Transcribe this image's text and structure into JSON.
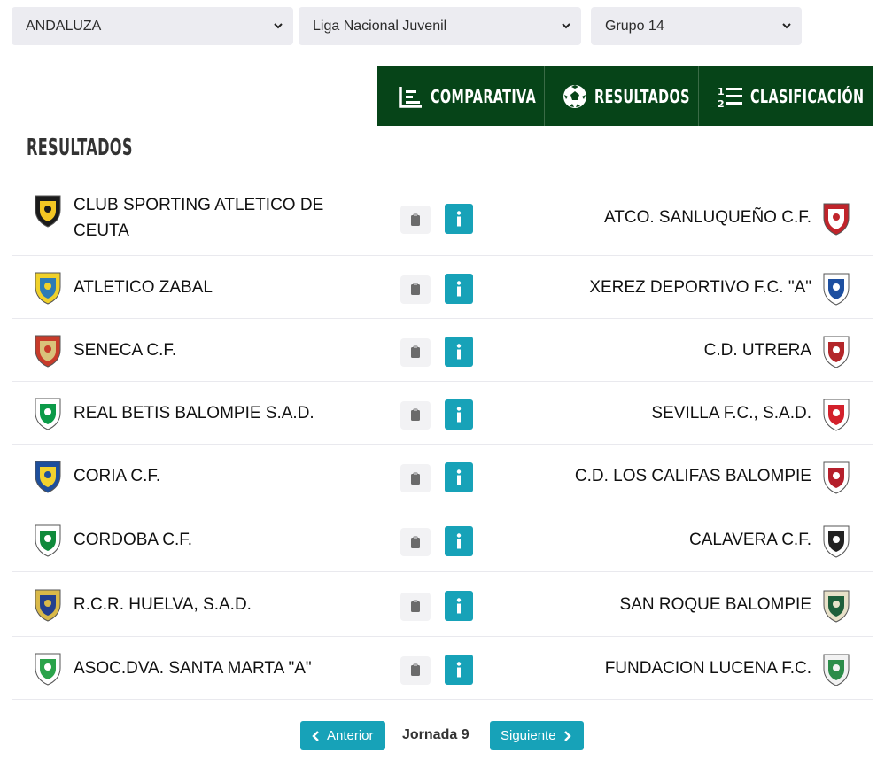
{
  "filters": {
    "region": "ANDALUZA",
    "competition": "Liga Nacional Juvenil",
    "group": "Grupo 14"
  },
  "tabs": [
    {
      "label": "COMPARATIVA",
      "icon": "bar-chart-icon"
    },
    {
      "label": "RESULTADOS",
      "icon": "soccer-ball-icon"
    },
    {
      "label": "CLASIFICACIÓN",
      "icon": "ranking-list-icon"
    }
  ],
  "section_title": "RESULTADOS",
  "matches": [
    {
      "home": "CLUB SPORTING ATLETICO DE CEUTA",
      "away": "ATCO. SANLUQUEÑO C.F.",
      "home_colors": [
        "#f3c623",
        "#1b1b1b"
      ],
      "away_colors": [
        "#ffffff",
        "#c0242b"
      ]
    },
    {
      "home": "ATLETICO ZABAL",
      "away": "XEREZ DEPORTIVO F.C. \"A\"",
      "home_colors": [
        "#2d7bb5",
        "#f0d12a"
      ],
      "away_colors": [
        "#1d4fa0",
        "#ffffff"
      ]
    },
    {
      "home": "SENECA C.F.",
      "away": "C.D. UTRERA",
      "home_colors": [
        "#d9c27a",
        "#c83b2a"
      ],
      "away_colors": [
        "#b3262a",
        "#ffffff"
      ]
    },
    {
      "home": "REAL BETIS BALOMPIE S.A.D.",
      "away": "SEVILLA F.C., S.A.D.",
      "home_colors": [
        "#0b9a48",
        "#ffffff"
      ],
      "away_colors": [
        "#d3202b",
        "#ffffff"
      ]
    },
    {
      "home": "CORIA C.F.",
      "away": "C.D. LOS CALIFAS BALOMPIE",
      "home_colors": [
        "#f2d22e",
        "#1e4f9c"
      ],
      "away_colors": [
        "#b51f2b",
        "#ffffff"
      ]
    },
    {
      "home": "CORDOBA C.F.",
      "away": "CALAVERA C.F.",
      "home_colors": [
        "#0f8a3b",
        "#ffffff"
      ],
      "away_colors": [
        "#222222",
        "#ffffff"
      ]
    },
    {
      "home": "R.C.R. HUELVA, S.A.D.",
      "away": "SAN ROQUE BALOMPIE",
      "home_colors": [
        "#233f8e",
        "#d9b949"
      ],
      "away_colors": [
        "#1e5f3a",
        "#e8e1c8"
      ]
    },
    {
      "home": "ASOC.DVA. SANTA MARTA \"A\"",
      "away": "FUNDACION LUCENA F.C.",
      "home_colors": [
        "#2aa34a",
        "#ffffff"
      ],
      "away_colors": [
        "#2c8d4a",
        "#f2f2f2"
      ]
    }
  ],
  "pager": {
    "prev_label": "Anterior",
    "current": "Jornada 9",
    "next_label": "Siguiente"
  },
  "colors": {
    "tab_bg": "#064418",
    "accent": "#17a2b8",
    "select_bg": "#ececf1"
  }
}
